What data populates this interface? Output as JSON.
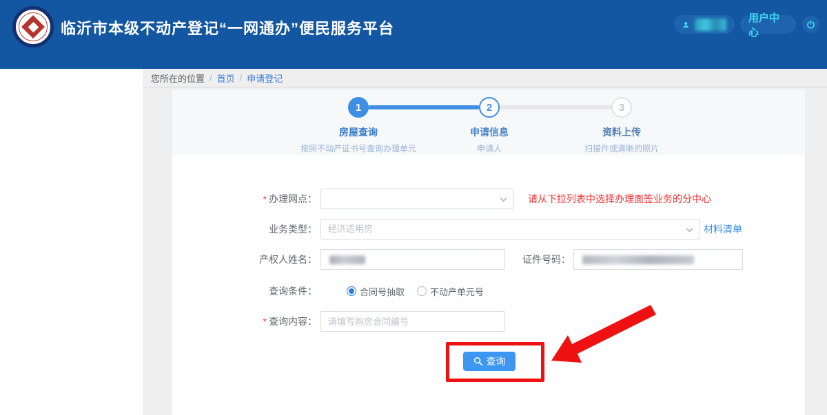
{
  "app": {
    "title": "临沂市本级不动产登记“一网通办”便民服务平台"
  },
  "header": {
    "user_name_masked": true,
    "user_center_label": "用户中心",
    "icons": [
      "user-icon",
      "power-icon"
    ],
    "colors": {
      "header_bg": "#1356a2",
      "accent_cyan": "#3fd9ee",
      "pill_bg": "#1d63ad"
    }
  },
  "breadcrumb": {
    "prefix": "您所在的位置",
    "sep1": "/",
    "home": "首页",
    "sep2": "/",
    "current": "申请登记"
  },
  "stepper": {
    "steps": [
      {
        "num": "1",
        "title": "房屋查询",
        "subtitle": "按照不动产证书号查询办理单元",
        "state": "done"
      },
      {
        "num": "2",
        "title": "申请信息",
        "subtitle": "申请人",
        "state": "current"
      },
      {
        "num": "3",
        "title": "资料上传",
        "subtitle": "扫描件或清晰的照片",
        "state": "pending"
      }
    ],
    "colors": {
      "active_blue": "#3e8ee4",
      "inactive_gray": "#e6e6e6"
    }
  },
  "form": {
    "required_mark": "*",
    "branch": {
      "label": "办理网点：",
      "value": "",
      "hint": "请从下拉列表中选择办理面签业务的分中心"
    },
    "business": {
      "label": "业务类型：",
      "value": "经济适用房",
      "link": "材料清单"
    },
    "owner": {
      "label": "产权人姓名：",
      "value_masked": true
    },
    "id_number": {
      "label": "证件号码：",
      "value_masked": true
    },
    "condition": {
      "label": "查询条件：",
      "options": [
        {
          "label": "合同号抽取",
          "selected": true
        },
        {
          "label": "不动产单元号",
          "selected": false
        }
      ]
    },
    "content": {
      "label": "查询内容：",
      "placeholder": "请填写购房合同编号",
      "value": ""
    },
    "submit_label": "查询",
    "colors": {
      "hint_red": "#f43030",
      "link_blue": "#3a8ee6",
      "button_blue": "#3d96f0"
    }
  },
  "annotation": {
    "color": "#ee1111",
    "shapes": [
      "rectangle-around-query-button",
      "arrow-pointing-to-query-button"
    ]
  }
}
